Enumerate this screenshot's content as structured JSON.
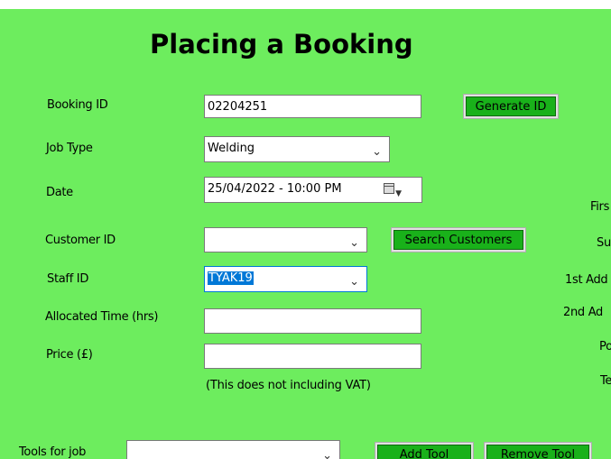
{
  "title": "Placing a Booking",
  "fields": {
    "booking_id": {
      "label": "Booking ID",
      "value": "02204251"
    },
    "job_type": {
      "label": "Job Type",
      "value": "Welding"
    },
    "date": {
      "label": "Date",
      "value": "25/04/2022 - 10:00 PM"
    },
    "customer_id": {
      "label": "Customer ID",
      "value": ""
    },
    "staff_id": {
      "label": "Staff ID",
      "value": "TYAK19"
    },
    "allocated_time": {
      "label": "Allocated Time (hrs)",
      "value": ""
    },
    "price": {
      "label": "Price (£)",
      "value": ""
    },
    "tools": {
      "label": "Tools for job",
      "value": ""
    }
  },
  "note": "(This does not including VAT)",
  "buttons": {
    "generate_id": "Generate ID",
    "search_customers": "Search Customers",
    "add_tool": "Add Tool",
    "remove_tool": "Remove Tool"
  },
  "right_labels": [
    "Firs",
    "Su",
    "1st Add",
    "2nd Ad",
    "Po",
    "Te"
  ],
  "icons": {
    "dropdown": "chevron-down-icon",
    "calendar": "calendar-icon"
  },
  "colors": {
    "form_background": "#6ded5e",
    "button_green": "#19b11a",
    "selection": "#0078d7"
  }
}
